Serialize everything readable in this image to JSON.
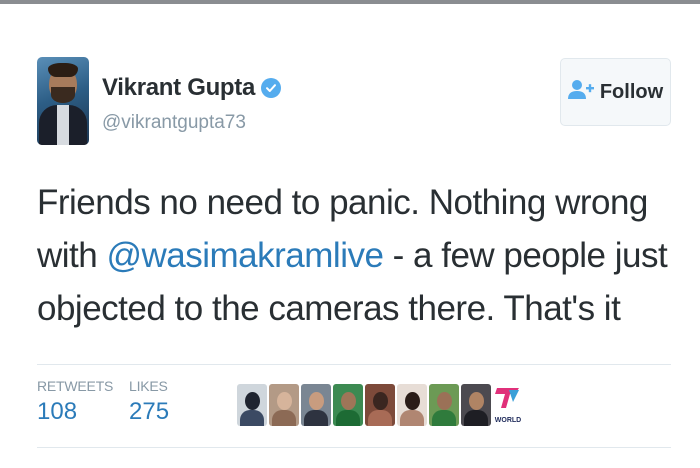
{
  "tweet": {
    "display_name": "Vikrant Gupta",
    "handle": "@vikrantgupta73",
    "text_before": "Friends no need to panic. Nothing wrong with ",
    "mention": "@wasimakramlive",
    "text_after": " - a few people just objected to the cameras there. That's it"
  },
  "follow_button": {
    "label": "Follow",
    "icon": "follow-user-icon"
  },
  "stats": {
    "retweets_label": "RETWEETS",
    "retweets_value": "108",
    "likes_label": "LIKES",
    "likes_value": "275"
  },
  "likers": {
    "last_badge_text": "WORLD"
  },
  "colors": {
    "link": "#2b7bb9",
    "verified": "#55acee",
    "muted": "#8899a6",
    "text": "#292f33",
    "divider": "#e1e8ed"
  }
}
